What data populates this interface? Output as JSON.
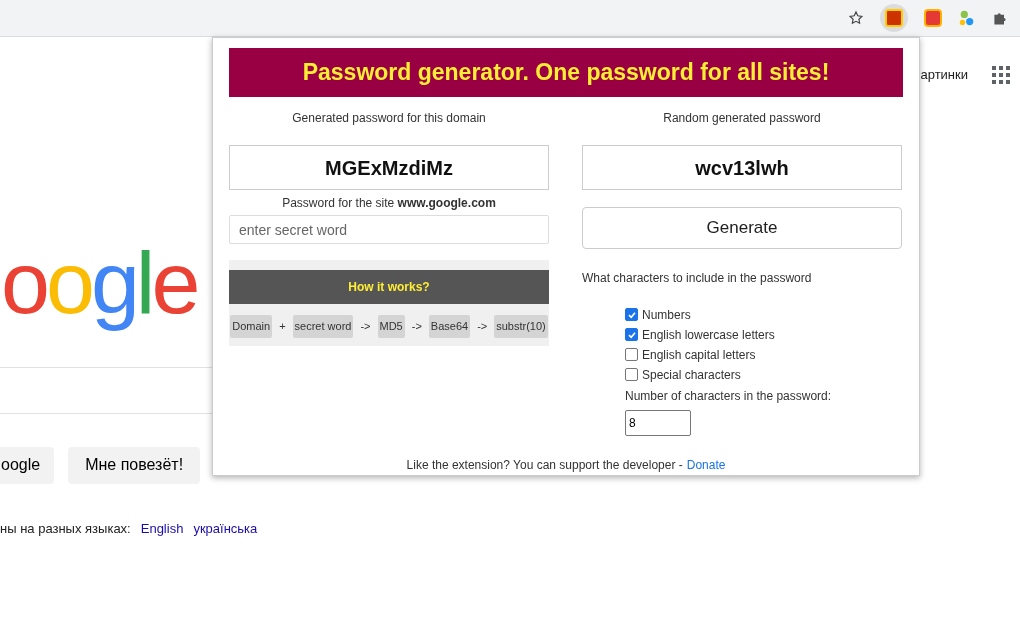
{
  "browser": {
    "page_link": "артинки",
    "logo": "oogle",
    "buttons": [
      "oogle",
      "Мне повезёт!"
    ],
    "languages_text": "ны на разных языках:",
    "languages": [
      "English",
      "українська"
    ]
  },
  "popup": {
    "title": "Password generator. One password for all sites!",
    "domain_label": "Generated password for this domain",
    "domain_password": "MGExMzdiMz",
    "site_label": "Password for the site **www.google.com**",
    "secret_placeholder": "enter secret word",
    "how_title": "How it works?",
    "how_steps": [
      {
        "kind": "step",
        "text": "Domain"
      },
      {
        "kind": "sep",
        "text": "+"
      },
      {
        "kind": "step",
        "text": "secret word"
      },
      {
        "kind": "sep",
        "text": "->"
      },
      {
        "kind": "step",
        "text": "MD5"
      },
      {
        "kind": "sep",
        "text": "->"
      },
      {
        "kind": "step",
        "text": "Base64"
      },
      {
        "kind": "sep",
        "text": "->"
      },
      {
        "kind": "step",
        "text": "substr(10)"
      }
    ],
    "random_label": "Random generated password",
    "random_password": "wcv13lwh",
    "generate_button": "Generate",
    "chars_label": "What characters to include in the password",
    "options": [
      {
        "label": "Numbers",
        "checked": true
      },
      {
        "label": "English lowercase letters",
        "checked": true
      },
      {
        "label": "English capital letters",
        "checked": false
      },
      {
        "label": "Special characters",
        "checked": false
      }
    ],
    "length_label": "Number of characters in the password:",
    "length_value": "8",
    "footer_text": "Like the extension? You can support the developer -",
    "donate_link": "Donate"
  }
}
